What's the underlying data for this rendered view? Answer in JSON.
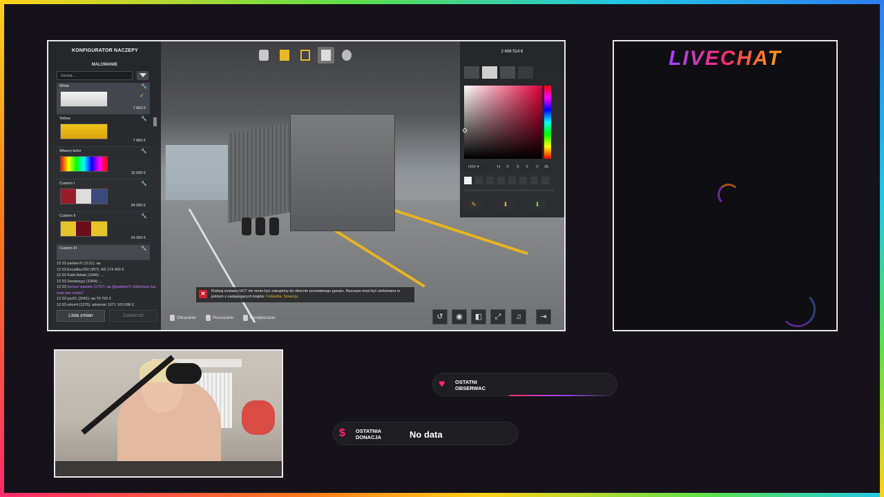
{
  "game": {
    "configurator": {
      "title": "KONFIGURATOR NACZEPY",
      "section": "MALOWANIE",
      "search_placeholder": "Szukaj...",
      "paints": [
        {
          "name": "White",
          "price": "7 800 €",
          "colors": [
            "#f4f4f4",
            "#cfcfcf"
          ],
          "selected": true
        },
        {
          "name": "Yellow",
          "price": "7 800 €",
          "colors": [
            "#f0c419",
            "#d9a50d"
          ]
        },
        {
          "name": "Własny kolor",
          "price": "15 600 €",
          "colors": [
            "#ff0000",
            "#00ff00"
          ]
        },
        {
          "name": "Custom I",
          "price": "24 000 €",
          "colors": [
            "#9a1c2a",
            "#dcdcdc",
            "#3a4a7a"
          ]
        },
        {
          "name": "Custom II",
          "price": "24 000 €",
          "colors": [
            "#e5c42a",
            "#6a0f1a",
            "#1a1a1a"
          ]
        },
        {
          "name": "Custom III",
          "price": "",
          "colors": [
            "#7a7a7a",
            "#bcbcbc"
          ]
        }
      ],
      "chat_lines": [
        {
          "time": "12:33",
          "text": "patolesTi (1121): aa"
        },
        {
          "time": "12:33",
          "text": "Excalibur260 (907): AS",
          "extra": "174 450 €"
        },
        {
          "time": "12:33",
          "text": "Kalel Arbak (1946): ..."
        },
        {
          "time": "12:33",
          "text": "Snowwyyy (1054): ..."
        },
        {
          "time": "12:33",
          "text": "hurouz wawino (1737): aa @patolesTi: Ekbiznize kat mak iser matia? "
        },
        {
          "time": "12:33",
          "text": "ipuX1 (2041): aa",
          "extra": "70 762 €"
        },
        {
          "time": "12:33",
          "text": "erkur4 (1375): adamsin 1071",
          "extra": "103 698 €"
        }
      ],
      "btn_list": "Lista zmian",
      "btn_confirm": "Zatwierdź"
    },
    "picker": {
      "money": "2 696 514 €",
      "mode": "HSV",
      "h_label": "H",
      "h_value": "0",
      "s_label": "S",
      "s_value": "0",
      "v_label": "V",
      "v_value": "36"
    },
    "warning": {
      "text_a": "Rodzaj zestawu HCT nie może być zakupiony do obecnie posiadanego garażu. Naczepa musi być ulokowana w jednym z następujących krajów: ",
      "countries": "Finlandia, Szwecja."
    },
    "actions": {
      "rotate": "Obracanie",
      "move": "Poruszanie",
      "zoom": "Powiększanie"
    }
  },
  "livechat": {
    "title": "LIVECHAT"
  },
  "alerts": {
    "follower_label_1": "OSTATNI",
    "follower_label_2": "OBSERWAC",
    "donation_label_1": "OSTATNIA",
    "donation_label_2": "DONACJA",
    "donation_value": "No data"
  }
}
